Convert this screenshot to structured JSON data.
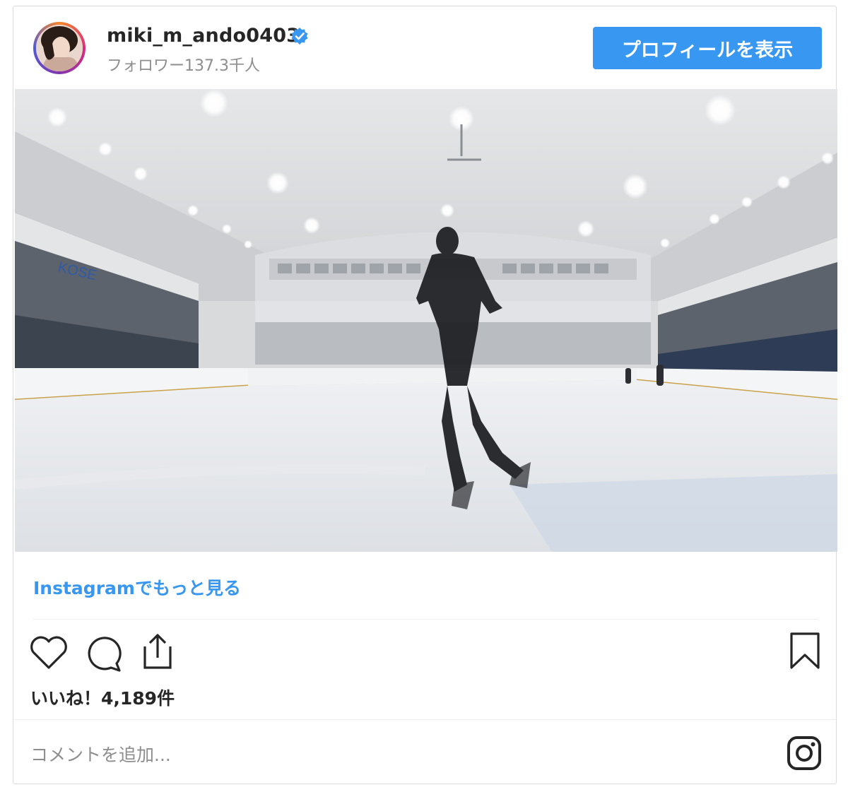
{
  "post": {
    "username": "miki_m_ando0403",
    "followers": "フォロワー137.3千人",
    "profile_button": "プロフィールを表示",
    "more_link": "Instagramでもっと見る",
    "likes": "いいね！4,189件",
    "comment_placeholder": "コメントを追加...",
    "media_signage": [
      "KOSE"
    ]
  },
  "colors": {
    "accent": "#3897f0",
    "verified": "#3897f0",
    "text": "#262626",
    "muted": "#8e8e8e",
    "border": "#dbdbdb"
  },
  "icons": [
    "verified-badge-icon",
    "heart-icon",
    "comment-icon",
    "share-icon",
    "bookmark-icon",
    "instagram-logo-icon"
  ]
}
